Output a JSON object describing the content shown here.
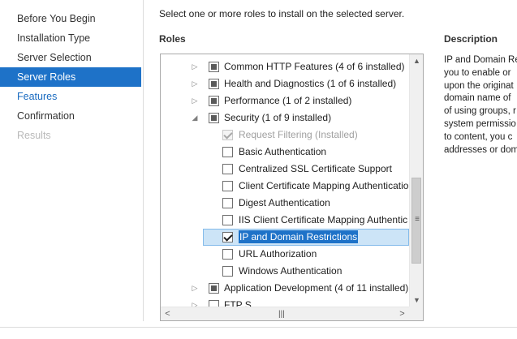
{
  "nav": {
    "items": [
      {
        "label": "Before You Begin",
        "state": "normal"
      },
      {
        "label": "Installation Type",
        "state": "normal"
      },
      {
        "label": "Server Selection",
        "state": "normal"
      },
      {
        "label": "Server Roles",
        "state": "selected"
      },
      {
        "label": "Features",
        "state": "link"
      },
      {
        "label": "Confirmation",
        "state": "normal"
      },
      {
        "label": "Results",
        "state": "disabled"
      }
    ]
  },
  "main": {
    "instruction": "Select one or more roles to install on the selected server.",
    "roles_heading": "Roles",
    "description_heading": "Description",
    "description_lines": [
      "IP and Domain Re",
      "you to enable or",
      "upon the originat",
      "domain name of",
      "of using groups, r",
      "system permissio",
      "to content, you c",
      "addresses or dom"
    ]
  },
  "roles_tree": {
    "rows": [
      {
        "label": "Common HTTP Features (4 of 6 installed)",
        "level": 0,
        "expander": "collapsed",
        "check": "indeterminate",
        "enabled": true
      },
      {
        "label": "Health and Diagnostics (1 of 6 installed)",
        "level": 0,
        "expander": "collapsed",
        "check": "indeterminate",
        "enabled": true
      },
      {
        "label": "Performance (1 of 2 installed)",
        "level": 0,
        "expander": "collapsed",
        "check": "indeterminate",
        "enabled": true
      },
      {
        "label": "Security (1 of 9 installed)",
        "level": 0,
        "expander": "expanded",
        "check": "indeterminate",
        "enabled": true
      },
      {
        "label": "Request Filtering (Installed)",
        "level": 1,
        "expander": "none",
        "check": "checked",
        "enabled": false
      },
      {
        "label": "Basic Authentication",
        "level": 1,
        "expander": "none",
        "check": "unchecked",
        "enabled": true
      },
      {
        "label": "Centralized SSL Certificate Support",
        "level": 1,
        "expander": "none",
        "check": "unchecked",
        "enabled": true
      },
      {
        "label": "Client Certificate Mapping Authenticatio",
        "level": 1,
        "expander": "none",
        "check": "unchecked",
        "enabled": true
      },
      {
        "label": "Digest Authentication",
        "level": 1,
        "expander": "none",
        "check": "unchecked",
        "enabled": true
      },
      {
        "label": "IIS Client Certificate Mapping Authentic",
        "level": 1,
        "expander": "none",
        "check": "unchecked",
        "enabled": true
      },
      {
        "label": "IP and Domain Restrictions",
        "level": 1,
        "expander": "none",
        "check": "checked",
        "enabled": true,
        "selected": true
      },
      {
        "label": "URL Authorization",
        "level": 1,
        "expander": "none",
        "check": "unchecked",
        "enabled": true
      },
      {
        "label": "Windows Authentication",
        "level": 1,
        "expander": "none",
        "check": "unchecked",
        "enabled": true
      },
      {
        "label": "Application Development (4 of 11 installed)",
        "level": 0,
        "expander": "collapsed",
        "check": "indeterminate",
        "enabled": true
      },
      {
        "label": "FTP S...",
        "level": 0,
        "expander": "collapsed",
        "check": "unchecked",
        "enabled": true
      }
    ]
  },
  "icons": {
    "collapsed": "▷",
    "expanded": "◢",
    "scroll_up": "▲",
    "scroll_down": "▼",
    "scroll_left": "<",
    "scroll_right": ">",
    "grip_v": "≡",
    "grip_h": "|||"
  },
  "colors": {
    "accent": "#1e72c8",
    "link": "#1a6bc0",
    "disabled": "#b9b9b9"
  }
}
